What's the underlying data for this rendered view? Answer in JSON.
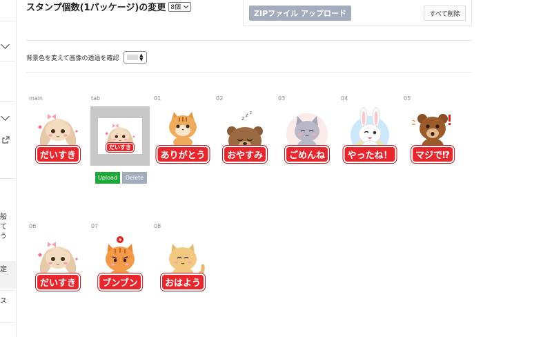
{
  "header": {
    "count_title": "スタンプ個数(1パッケージ)の変更",
    "count_value": "8個",
    "zip_upload_label": "ZIPファイル アップロード",
    "delete_all_label": "すべて削除"
  },
  "background_check": {
    "label": "背景色を変えて画像の透過を確認",
    "selected_color": "#dcdcdc"
  },
  "sidebar": {
    "text_fragments": [
      "船\nて\nう",
      "定",
      "ス"
    ]
  },
  "stickers": [
    {
      "slot": "main",
      "caption": "だいすき",
      "character": "bunny-girl"
    },
    {
      "slot": "tab",
      "caption": "だいすき",
      "character": "bunny-girl"
    },
    {
      "slot": "01",
      "caption": "ありがとう",
      "character": "tabby-cat"
    },
    {
      "slot": "02",
      "caption": "おやすみ",
      "character": "sleepy-bear"
    },
    {
      "slot": "03",
      "caption": "ごめんね",
      "character": "gray-cat"
    },
    {
      "slot": "04",
      "caption": "やったね！",
      "character": "white-rabbit"
    },
    {
      "slot": "05",
      "caption": "マジで⁉",
      "character": "brown-bear"
    },
    {
      "slot": "06",
      "caption": "だいすき",
      "character": "bunny-girl"
    },
    {
      "slot": "07",
      "caption": "ブンブン",
      "character": "angry-cat"
    },
    {
      "slot": "08",
      "caption": "おはよう",
      "character": "cream-cat"
    }
  ],
  "tab_actions": {
    "upload_label": "Upload",
    "delete_label": "Delete"
  },
  "colors": {
    "caption_red": "#e8262d",
    "upload_green": "#1fa83a",
    "disabled_gray": "#a3acbc"
  }
}
